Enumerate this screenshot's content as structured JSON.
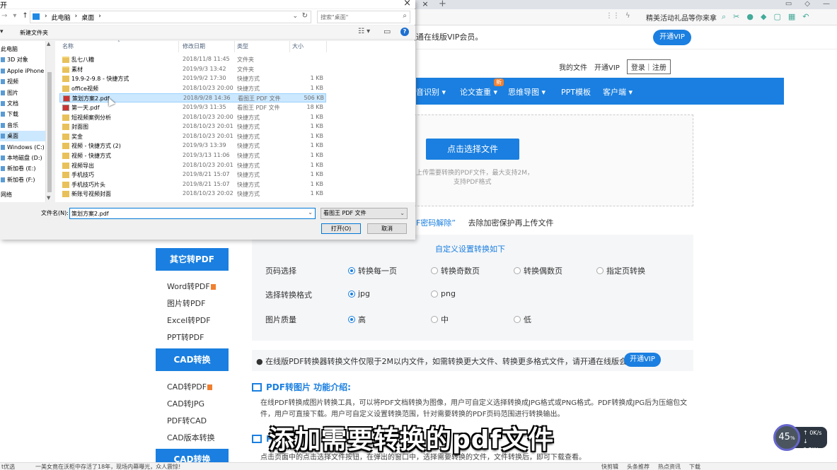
{
  "browser": {
    "tab_close": "×",
    "new_tab": "+",
    "promo_text": "精美活动礼品等你来拿",
    "vip_text": "通在线版VIP会员。",
    "vip_button": "开通VIP",
    "my_files": "我的文件",
    "open_vip": "开通VIP",
    "login_register": "登录｜注册",
    "nav": [
      "音识别",
      "论文查重",
      "思维导图",
      "PPT模板",
      "客户端"
    ],
    "new_badge": "新",
    "upload_button": "点击选择文件",
    "upload_hint1": "上传需要转换的PDF文件，最大支持2M，",
    "upload_hint2": "支持PDF格式",
    "pwd_link": "F密码解除”",
    "pwd_text": "去除加密保护再上传文件",
    "sidebar": {
      "head1": "其它转PDF",
      "items1": [
        "Word转PDF",
        "图片转PDF",
        "Excel转PDF",
        "PPT转PDF"
      ],
      "head2": "CAD转换",
      "items2": [
        "CAD转PDF",
        "CAD转JPG",
        "PDF转CAD",
        "CAD版本转换"
      ],
      "head3": "CAD转换"
    },
    "options": {
      "title": "自定义设置转换如下",
      "page_label": "页码选择",
      "page_opts": [
        "转换每一页",
        "转换奇数页",
        "转换偶数页",
        "指定页转换"
      ],
      "format_label": "选择转换格式",
      "format_opts": [
        "jpg",
        "png"
      ],
      "quality_label": "图片质量",
      "quality_opts": [
        "高",
        "中",
        "低"
      ]
    },
    "note_text": "在线版PDF转换器转换文件仅限于2M以内文件，如需转换更大文件、转换更多格式文件，请开通在线版会员。",
    "note_button": "开通VIP",
    "section_title": "PDF转图片 功能介绍:",
    "section_body": "在线PDF转换成图片转换工具，可以将PDF文档转换为图像，用户可自定义选择转换成JPG格式或PNG格式。PDF转换成JPG后为压缩包文件，用户可直接下载。用户可自定义设置转换范围，针对需要转换的PDF页码范围进行转换输出。",
    "section2_title": "P",
    "section2_body": "点击页面中的点击选择文件按钮，在弹出的窗口中，选择需要转换的文件，文件转换后，即可下载查看。",
    "subtitle": "添加需要转换的pdf文件",
    "gauge_value": "45",
    "gauge_unit": "%",
    "gauge_up": "0K/s",
    "gauge_down": "0.2K/s",
    "status_left": "t优选",
    "status_news": "一美女竟在沃柜中存活了18年，现场内幕曝光，众人震惊!",
    "status_right": [
      "快剪辑",
      "头条推荐",
      "热点资讯",
      "下载"
    ]
  },
  "dialog": {
    "title": "开",
    "close": "×",
    "path": [
      "此电脑",
      "桌面"
    ],
    "search_placeholder": "搜索\"桌面\"",
    "organize": "▾",
    "new_folder": "新建文件夹",
    "help": "?",
    "nav_items": [
      "此电脑",
      "3D 对象",
      "Apple iPhone",
      "视频",
      "图片",
      "文档",
      "下载",
      "音乐",
      "桌面",
      "Windows (C:)",
      "本地磁盘 (D:)",
      "新加卷 (E:)",
      "新加卷 (F:)",
      "网络"
    ],
    "columns": [
      "名称",
      "修改日期",
      "类型",
      "大小"
    ],
    "files": [
      {
        "name": "乱七八糟",
        "date": "2018/11/8 11:45",
        "type": "文件夹",
        "size": "",
        "icon": "folder"
      },
      {
        "name": "素材",
        "date": "2019/9/3 13:42",
        "type": "文件夹",
        "size": "",
        "icon": "folder"
      },
      {
        "name": "19.9-2-9.8 - 快捷方式",
        "date": "2019/9/2 17:30",
        "type": "快捷方式",
        "size": "1 KB",
        "icon": "shortcut"
      },
      {
        "name": "office视频",
        "date": "2018/10/23 20:00",
        "type": "快捷方式",
        "size": "1 KB",
        "icon": "shortcut"
      },
      {
        "name": "策划方案2.pdf",
        "date": "2018/9/28 14:36",
        "type": "看图王 PDF 文件",
        "size": "506 KB",
        "icon": "pdf"
      },
      {
        "name": "第一天.pdf",
        "date": "2019/9/3 11:35",
        "type": "看图王 PDF 文件",
        "size": "18 KB",
        "icon": "pdf"
      },
      {
        "name": "短视频案例分析",
        "date": "2018/10/23 20:00",
        "type": "快捷方式",
        "size": "1 KB",
        "icon": "shortcut"
      },
      {
        "name": "封面图",
        "date": "2018/10/23 20:01",
        "type": "快捷方式",
        "size": "1 KB",
        "icon": "shortcut"
      },
      {
        "name": "奖金",
        "date": "2018/10/23 20:01",
        "type": "快捷方式",
        "size": "1 KB",
        "icon": "shortcut"
      },
      {
        "name": "视频 - 快捷方式 (2)",
        "date": "2019/9/3 13:39",
        "type": "快捷方式",
        "size": "1 KB",
        "icon": "shortcut"
      },
      {
        "name": "视频 - 快捷方式",
        "date": "2019/3/13 11:06",
        "type": "快捷方式",
        "size": "1 KB",
        "icon": "shortcut"
      },
      {
        "name": "视频导出",
        "date": "2018/10/23 20:01",
        "type": "快捷方式",
        "size": "1 KB",
        "icon": "shortcut"
      },
      {
        "name": "手机技巧",
        "date": "2019/8/21 15:07",
        "type": "快捷方式",
        "size": "1 KB",
        "icon": "shortcut"
      },
      {
        "name": "手机技巧片头",
        "date": "2019/8/21 15:07",
        "type": "快捷方式",
        "size": "1 KB",
        "icon": "shortcut"
      },
      {
        "name": "新账号视频封面",
        "date": "2018/10/23 20:02",
        "type": "快捷方式",
        "size": "1 KB",
        "icon": "shortcut"
      }
    ],
    "filename_label": "文件名(N):",
    "filename_value": "策划方案2.pdf",
    "filetype_value": "看图王 PDF 文件",
    "open_button": "打开(O)",
    "cancel_button": "取消"
  }
}
